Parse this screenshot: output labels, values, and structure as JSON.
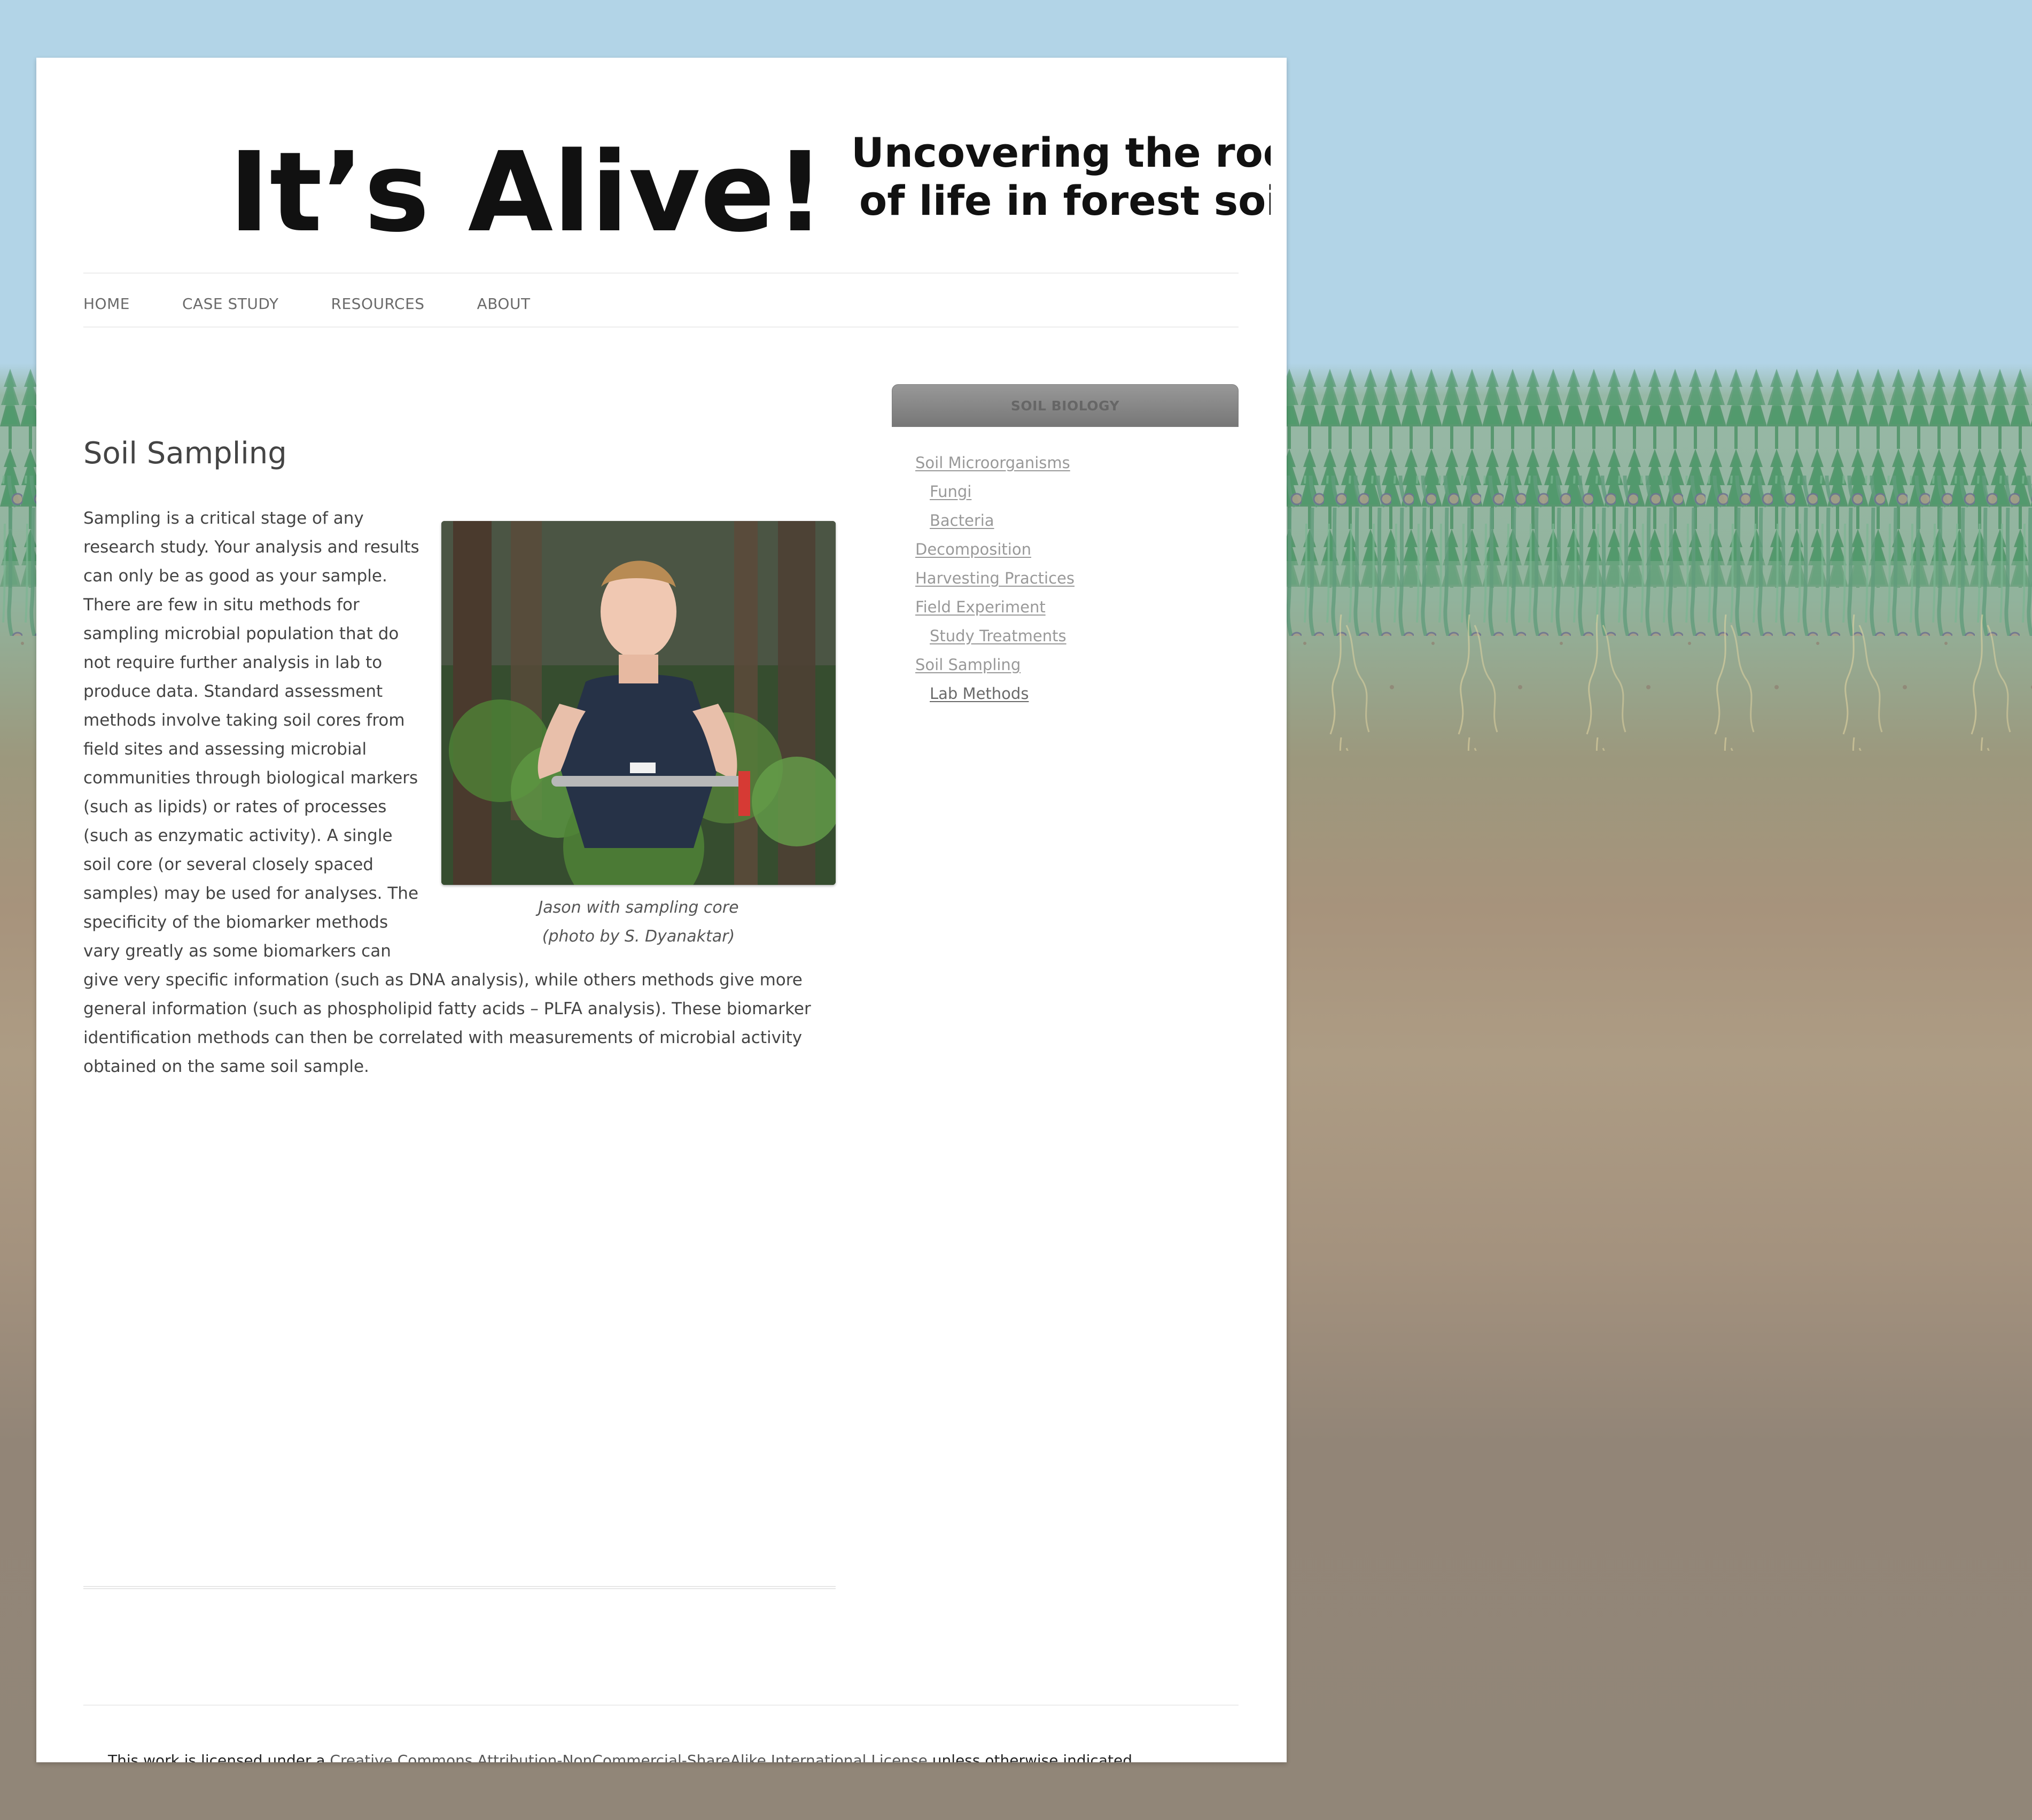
{
  "header": {
    "logo_text": "It’s Alive!",
    "tagline_line1": "Uncovering the roots",
    "tagline_line2": "of life in forest soils"
  },
  "nav": {
    "items": [
      {
        "label": "HOME"
      },
      {
        "label": "CASE STUDY"
      },
      {
        "label": "RESOURCES"
      },
      {
        "label": "ABOUT"
      }
    ]
  },
  "article": {
    "title": "Soil Sampling",
    "body": "Sampling is a critical stage of any research study.  Your analysis and results can only be as good as your sample. There are few in situ methods for sampling microbial population that do not require further analysis in lab to produce data.  Standard assessment methods involve taking soil cores from field sites and assessing microbial communities through biological markers (such as lipids) or rates of processes (such as enzymatic activity). A single soil core (or several closely spaced samples) may be used for analyses. The specificity of the biomarker methods vary greatly as some biomarkers can give very specific information (such as DNA analysis), while others methods give more general information (such as phospholipid fatty acids – PLFA analysis). These biomarker identification methods can then be correlated with measurements of microbial activity obtained on the same soil sample.",
    "figure": {
      "caption_line1": "Jason with sampling core",
      "caption_line2": "(photo by S. Dyanaktar)"
    }
  },
  "sidebar": {
    "widget_title": "SOIL BIOLOGY",
    "items": [
      {
        "label": "Soil Microorganisms"
      },
      {
        "label": "Fungi"
      },
      {
        "label": "Bacteria"
      },
      {
        "label": "Decomposition"
      },
      {
        "label": "Harvesting Practices"
      },
      {
        "label": "Field Experiment"
      },
      {
        "label": "Study Treatments"
      },
      {
        "label": "Soil Sampling"
      },
      {
        "label": "Lab Methods"
      }
    ]
  },
  "footer": {
    "prefix": "This work is licensed under a ",
    "license_link": "Creative Commons Attribution-NonCommercial-ShareAlike International License",
    "suffix": " unless otherwise indicated."
  },
  "colors": {
    "sky": "#b2d4e7",
    "forest": "#91b39c",
    "soil": "#918678",
    "page": "#ffffff",
    "text": "#444444",
    "link": "#999999",
    "widget_header": "#808080"
  }
}
